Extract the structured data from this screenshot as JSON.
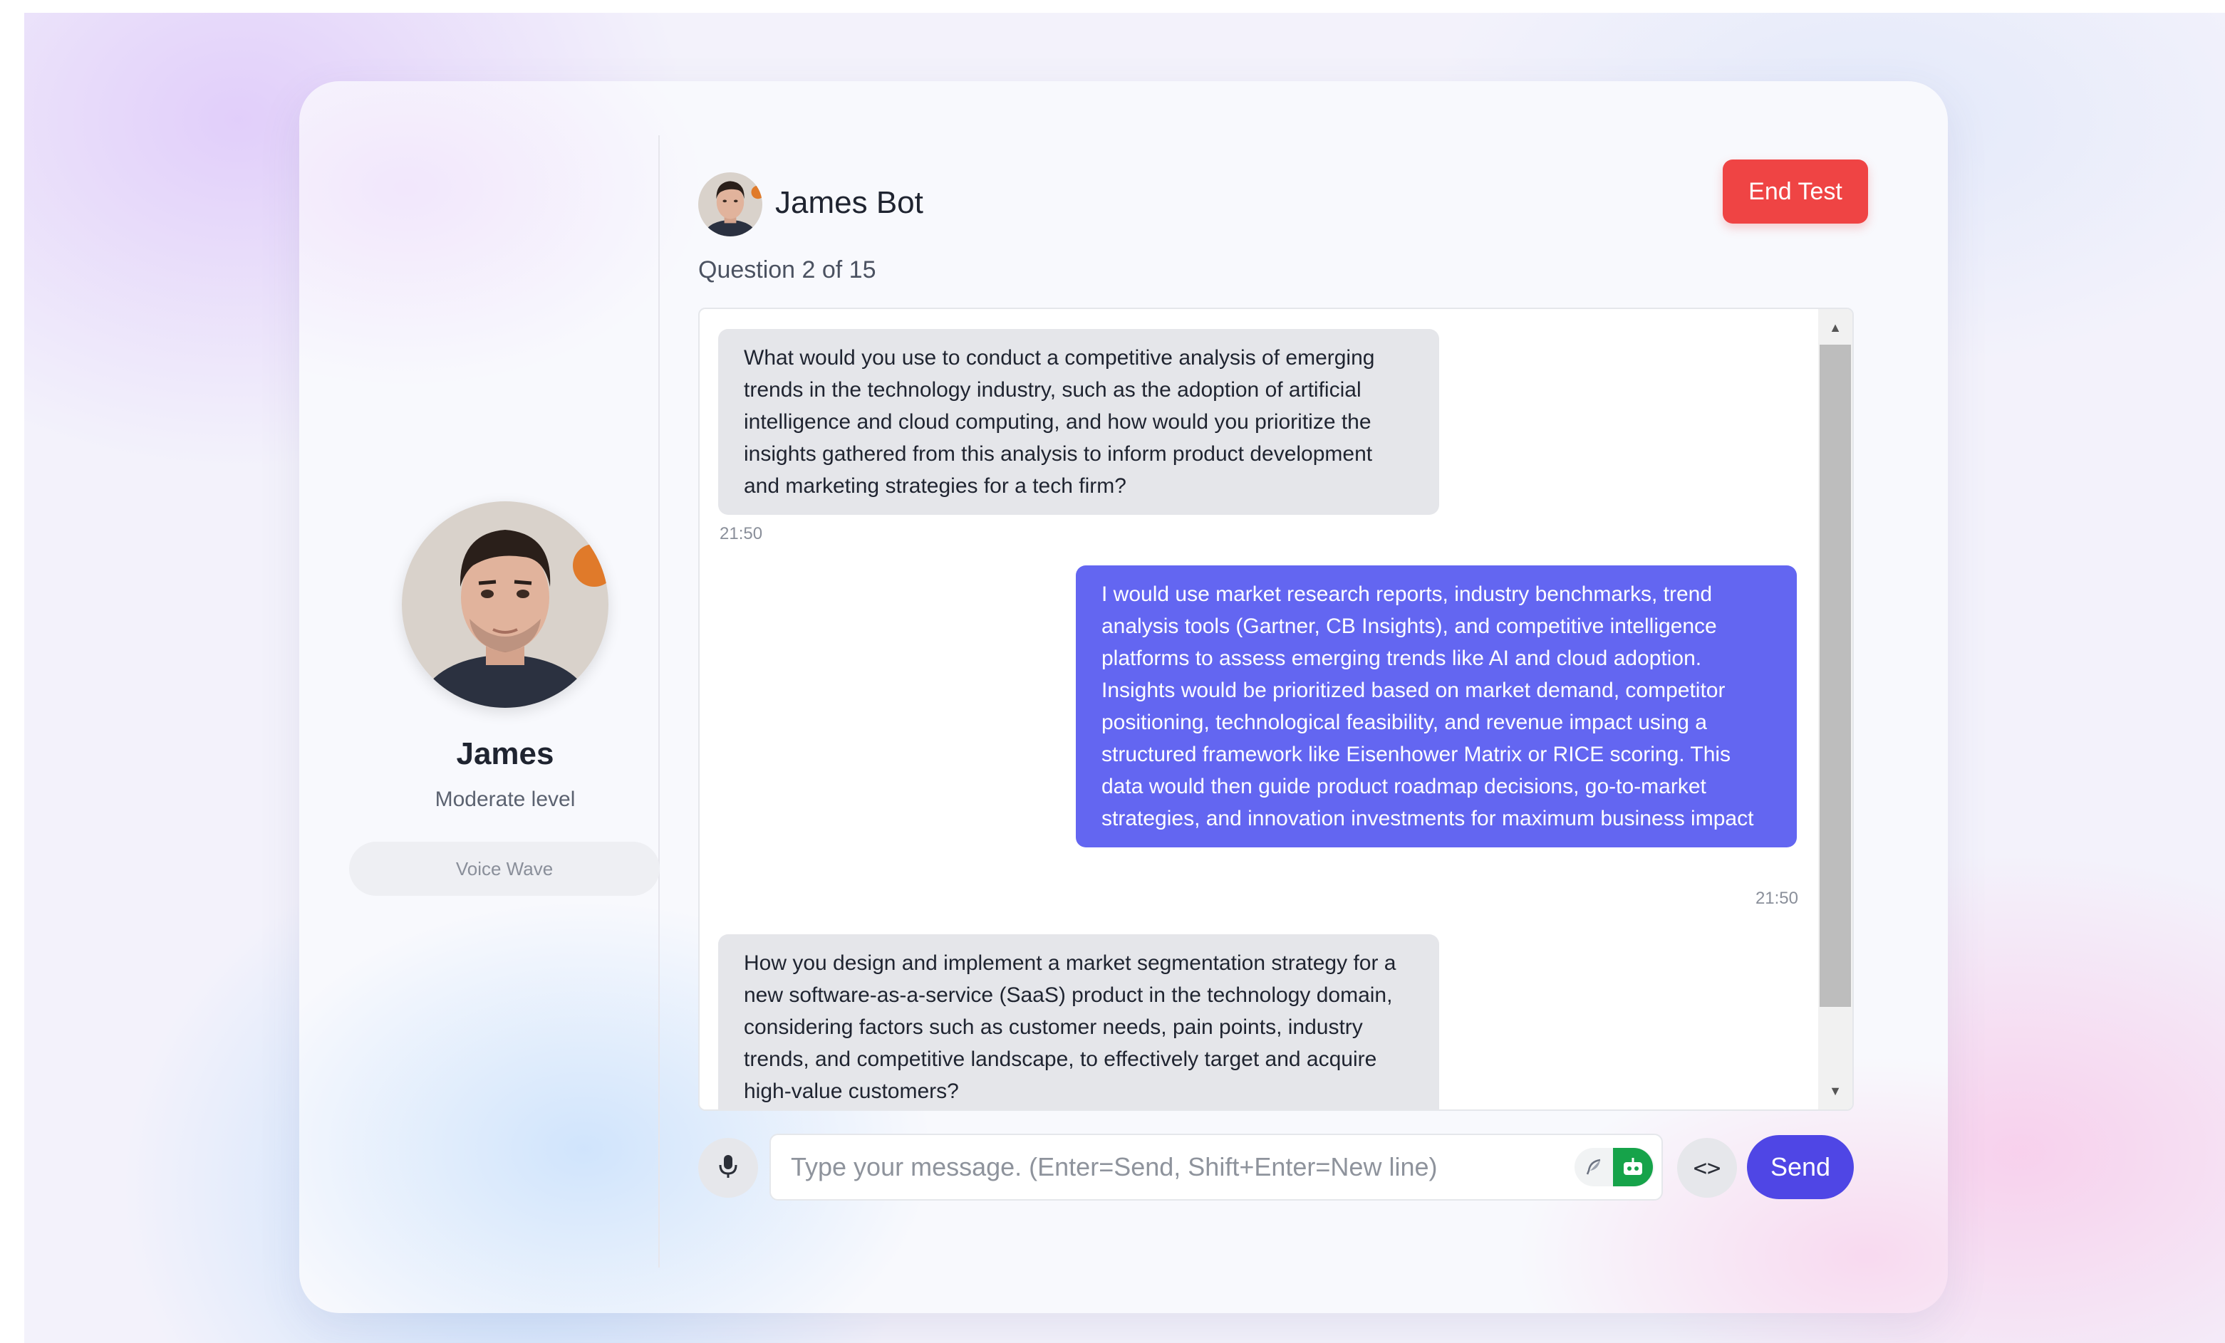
{
  "profile": {
    "name": "James",
    "level": "Moderate level",
    "voice_wave_label": "Voice Wave"
  },
  "header": {
    "bot_name": "James Bot",
    "question_progress": "Question 2 of 15",
    "end_test_label": "End Test"
  },
  "messages": [
    {
      "role": "bot",
      "text": "What would you use to conduct a competitive analysis of emerging trends in the technology industry, such as the adoption of artificial intelligence and cloud computing, and how would you prioritize the insights gathered from this analysis to inform product development and marketing strategies for a tech firm?",
      "time": "21:50"
    },
    {
      "role": "user",
      "text": "I would use market research reports, industry benchmarks, trend analysis tools (Gartner, CB Insights), and competitive intelligence platforms to assess emerging trends like AI and cloud adoption. Insights would be prioritized based on market demand, competitor positioning, technological feasibility, and revenue impact using a structured framework like Eisenhower Matrix or RICE scoring. This data would then guide product roadmap decisions, go-to-market strategies, and innovation investments for maximum business impact",
      "time": "21:50"
    },
    {
      "role": "bot",
      "text": "How you design and implement a market segmentation strategy for a new software-as-a-service (SaaS) product in the technology domain, considering factors such as customer needs, pain points, industry trends, and competitive landscape, to effectively target and acquire high-value customers?"
    }
  ],
  "composer": {
    "placeholder": "Type your message. (Enter=Send, Shift+Enter=New line)",
    "value": "",
    "send_label": "Send",
    "icons": [
      "mic-icon",
      "feather-icon",
      "bot-icon",
      "code-icon"
    ]
  },
  "colors": {
    "accent": "#4f46e5",
    "user_bubble": "#6366f1",
    "bot_bubble": "#e5e6ea",
    "end_test": "#ef4444"
  }
}
